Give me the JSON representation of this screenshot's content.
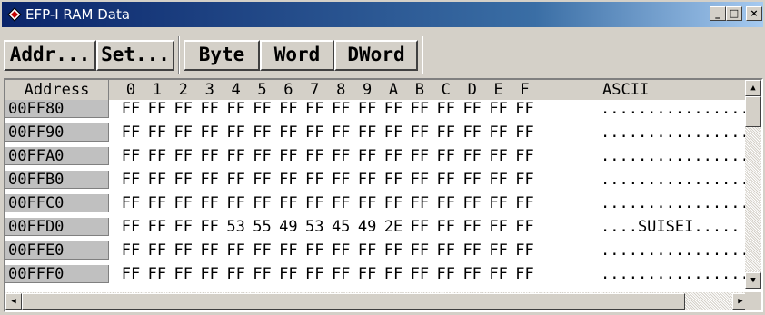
{
  "window": {
    "title": "EFP-I RAM Data"
  },
  "titlebar": {
    "minimize": "_",
    "maximize": "□",
    "close": "×"
  },
  "toolbar": {
    "addr": "Addr...",
    "set": "Set...",
    "byte": "Byte",
    "word": "Word",
    "dword": "DWord"
  },
  "table": {
    "address_header": "Address",
    "columns": [
      "0",
      "1",
      "2",
      "3",
      "4",
      "5",
      "6",
      "7",
      "8",
      "9",
      "A",
      "B",
      "C",
      "D",
      "E",
      "F"
    ],
    "ascii_header": "ASCII",
    "rows": [
      {
        "addr": "00FF80",
        "bytes": [
          "FF",
          "FF",
          "FF",
          "FF",
          "FF",
          "FF",
          "FF",
          "FF",
          "FF",
          "FF",
          "FF",
          "FF",
          "FF",
          "FF",
          "FF",
          "FF"
        ],
        "ascii": "................"
      },
      {
        "addr": "00FF90",
        "bytes": [
          "FF",
          "FF",
          "FF",
          "FF",
          "FF",
          "FF",
          "FF",
          "FF",
          "FF",
          "FF",
          "FF",
          "FF",
          "FF",
          "FF",
          "FF",
          "FF"
        ],
        "ascii": "................"
      },
      {
        "addr": "00FFA0",
        "bytes": [
          "FF",
          "FF",
          "FF",
          "FF",
          "FF",
          "FF",
          "FF",
          "FF",
          "FF",
          "FF",
          "FF",
          "FF",
          "FF",
          "FF",
          "FF",
          "FF"
        ],
        "ascii": "................"
      },
      {
        "addr": "00FFB0",
        "bytes": [
          "FF",
          "FF",
          "FF",
          "FF",
          "FF",
          "FF",
          "FF",
          "FF",
          "FF",
          "FF",
          "FF",
          "FF",
          "FF",
          "FF",
          "FF",
          "FF"
        ],
        "ascii": "................"
      },
      {
        "addr": "00FFC0",
        "bytes": [
          "FF",
          "FF",
          "FF",
          "FF",
          "FF",
          "FF",
          "FF",
          "FF",
          "FF",
          "FF",
          "FF",
          "FF",
          "FF",
          "FF",
          "FF",
          "FF"
        ],
        "ascii": "................"
      },
      {
        "addr": "00FFD0",
        "bytes": [
          "FF",
          "FF",
          "FF",
          "FF",
          "53",
          "55",
          "49",
          "53",
          "45",
          "49",
          "2E",
          "FF",
          "FF",
          "FF",
          "FF",
          "FF"
        ],
        "ascii": "....SUISEI....."
      },
      {
        "addr": "00FFE0",
        "bytes": [
          "FF",
          "FF",
          "FF",
          "FF",
          "FF",
          "FF",
          "FF",
          "FF",
          "FF",
          "FF",
          "FF",
          "FF",
          "FF",
          "FF",
          "FF",
          "FF"
        ],
        "ascii": "................"
      },
      {
        "addr": "00FFF0",
        "bytes": [
          "FF",
          "FF",
          "FF",
          "FF",
          "FF",
          "FF",
          "FF",
          "FF",
          "FF",
          "FF",
          "FF",
          "FF",
          "FF",
          "FF",
          "FF",
          "FF"
        ],
        "ascii": "................"
      }
    ]
  },
  "scrollbars": {
    "up": "▲",
    "down": "▼",
    "left": "◀",
    "right": "▶"
  }
}
